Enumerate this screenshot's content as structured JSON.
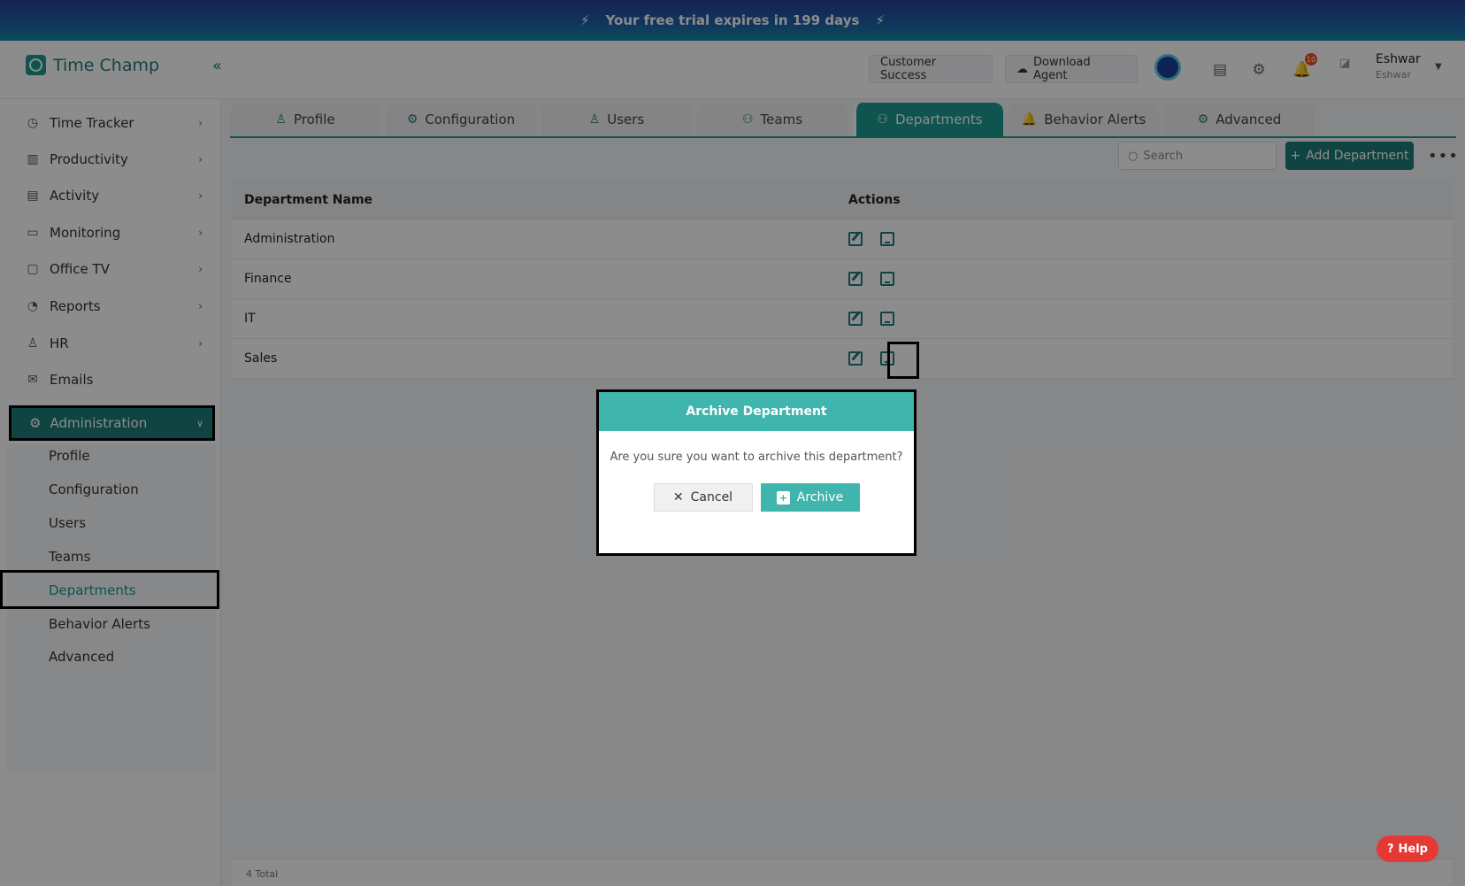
{
  "banner": {
    "text": "Your free trial expires in 199 days",
    "bolt": "⚡"
  },
  "brand": {
    "name": "Time Champ",
    "collapse": "«"
  },
  "topbar": {
    "customer_success": "Customer Success",
    "download_agent": "Download Agent",
    "notifications_count": "10",
    "user_name": "Eshwar",
    "user_sub": "Eshwar"
  },
  "sidebar": {
    "items": [
      {
        "label": "Time Tracker",
        "icon": "◷"
      },
      {
        "label": "Productivity",
        "icon": "▥"
      },
      {
        "label": "Activity",
        "icon": "▤"
      },
      {
        "label": "Monitoring",
        "icon": "▭"
      },
      {
        "label": "Office TV",
        "icon": "▢"
      },
      {
        "label": "Reports",
        "icon": "◔"
      },
      {
        "label": "HR",
        "icon": "♙"
      },
      {
        "label": "Emails",
        "icon": "✉"
      }
    ],
    "admin_label": "Administration",
    "sub_items": [
      "Profile",
      "Configuration",
      "Users",
      "Teams",
      "Departments",
      "Behavior Alerts",
      "Advanced"
    ]
  },
  "tabs": [
    {
      "label": "Profile",
      "icon": "♙"
    },
    {
      "label": "Configuration",
      "icon": "⚙"
    },
    {
      "label": "Users",
      "icon": "♙"
    },
    {
      "label": "Teams",
      "icon": "⚇"
    },
    {
      "label": "Departments",
      "icon": "⚇"
    },
    {
      "label": "Behavior Alerts",
      "icon": "🔔"
    },
    {
      "label": "Advanced",
      "icon": "⚙"
    }
  ],
  "toolbar": {
    "search_placeholder": "Search",
    "add_label": "Add Department",
    "more": "•••"
  },
  "table": {
    "headers": [
      "Department Name",
      "Actions"
    ],
    "rows": [
      "Administration",
      "Finance",
      "IT",
      "Sales"
    ]
  },
  "footer": {
    "total": "4 Total"
  },
  "help": {
    "label": "Help"
  },
  "modal": {
    "title": "Archive Department",
    "message": "Are you sure you want to archive this department?",
    "cancel_label": "Cancel",
    "archive_label": "Archive"
  },
  "colors": {
    "primary": "#1c7d78",
    "accent": "#3fb5ad",
    "help": "#e53935",
    "badge": "#e8531f"
  }
}
